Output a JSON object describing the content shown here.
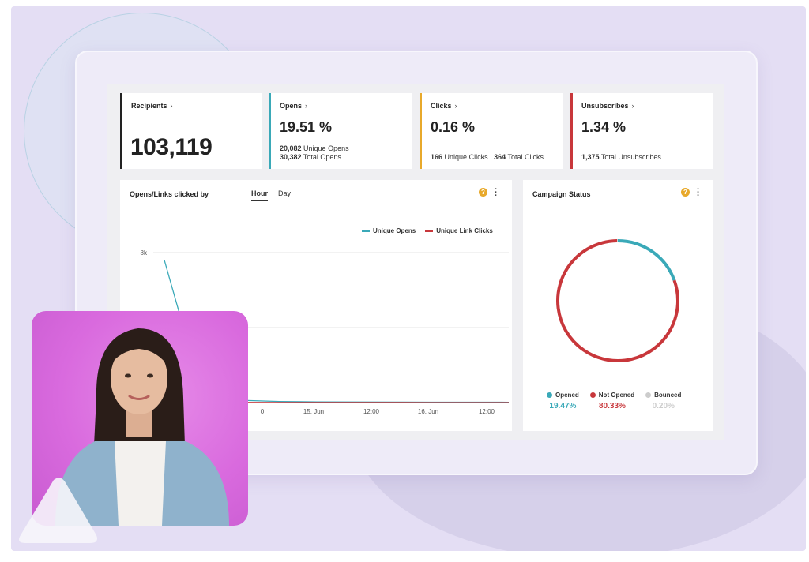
{
  "stats": [
    {
      "title": "Recipients",
      "chevron": "›",
      "value": "103,119",
      "color": "#222222"
    },
    {
      "title": "Opens",
      "chevron": "›",
      "value": "19.51 %",
      "color": "#3aa9b8",
      "line1_num": "20,082",
      "line1_label": "Unique Opens",
      "line2_num": "30,382",
      "line2_label": "Total Opens"
    },
    {
      "title": "Clicks",
      "chevron": "›",
      "value": "0.16 %",
      "color": "#e8a92b",
      "line1_num": "166",
      "line1_label": "Unique Clicks",
      "line1b_num": "364",
      "line1b_label": "Total Clicks"
    },
    {
      "title": "Unsubscribes",
      "chevron": "›",
      "value": "1.34 %",
      "color": "#c8373b",
      "line1_num": "1,375",
      "line1_label": "Total Unsubscribes"
    }
  ],
  "opens_panel": {
    "title": "Opens/Links clicked by",
    "tabs": [
      "Hour",
      "Day"
    ],
    "active_tab": "Hour",
    "help_icon": "question-icon",
    "menu_icon": "kebab-icon"
  },
  "chart_data": {
    "type": "line",
    "legend": [
      "Unique Opens",
      "Unique Link Clicks"
    ],
    "legend_placement": "top-right",
    "ytick_labels": [
      "8k"
    ],
    "xtick_labels": [
      "0",
      "15. Jun",
      "12:00",
      "16. Jun",
      "12:00"
    ],
    "ylim": [
      0,
      8000
    ],
    "grid": true,
    "series": [
      {
        "name": "Unique Opens",
        "color": "#3aa9b8",
        "values": [
          7600,
          400,
          120,
          60,
          40,
          30,
          25,
          20,
          20,
          15
        ]
      },
      {
        "name": "Unique Link Clicks",
        "color": "#c8373b",
        "values": [
          0,
          10,
          8,
          5,
          4,
          3,
          3,
          2,
          2,
          2
        ]
      }
    ]
  },
  "status_panel": {
    "title": "Campaign Status",
    "help_icon": "question-icon",
    "menu_icon": "kebab-icon",
    "chart_data": {
      "type": "pie",
      "segments": [
        {
          "label": "Opened",
          "value": 19.47,
          "display": "19.47%",
          "color": "#3aa9b8"
        },
        {
          "label": "Not Opened",
          "value": 80.33,
          "display": "80.33%",
          "color": "#c8373b"
        },
        {
          "label": "Bounced",
          "value": 0.2,
          "display": "0.20%",
          "color": "#cccccc"
        }
      ]
    }
  }
}
